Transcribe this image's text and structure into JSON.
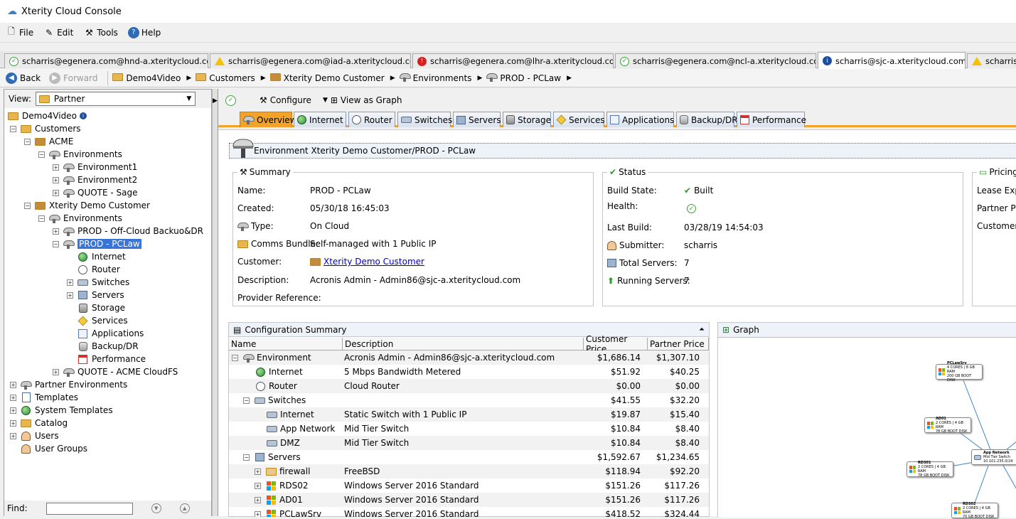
{
  "window": {
    "title": "Xterity Cloud Console"
  },
  "menu": [
    {
      "label": "File",
      "icon": "file-icon"
    },
    {
      "label": "Edit",
      "icon": "edit-icon"
    },
    {
      "label": "Tools",
      "icon": "tools-icon"
    },
    {
      "label": "Help",
      "icon": "help-icon"
    }
  ],
  "session_tabs": [
    {
      "label": "scharris@egenera.com@hnd-a.xteritycloud.com",
      "status": "ok"
    },
    {
      "label": "scharris@egenera.com@iad-a.xteritycloud.com",
      "status": "warning"
    },
    {
      "label": "scharris@egenera.com@lhr-a.xteritycloud.com",
      "status": "error"
    },
    {
      "label": "scharris@egenera.com@ncl-a.xteritycloud.com",
      "status": "ok"
    },
    {
      "label": "scharris@sjc-a.xteritycloud.com",
      "status": "info",
      "active": true
    },
    {
      "label": "scharris",
      "status": "warning"
    }
  ],
  "nav": {
    "back": "Back",
    "forward": "Forward",
    "breadcrumbs": [
      "Demo4Video",
      "Customers",
      "Xterity Demo Customer",
      "Environments",
      "PROD - PCLaw"
    ]
  },
  "left": {
    "view_label": "View:",
    "view_value": "Partner",
    "find_label": "Find:",
    "tree": [
      {
        "label": "Demo4Video",
        "info": true
      },
      {
        "label": "Customers"
      },
      {
        "label": "ACME"
      },
      {
        "label": "Environments"
      },
      {
        "label": "Environment1"
      },
      {
        "label": "Environment2"
      },
      {
        "label": "QUOTE - Sage"
      },
      {
        "label": "Xterity Demo Customer"
      },
      {
        "label": "Environments"
      },
      {
        "label": "PROD - Off-Cloud Backuo&DR"
      },
      {
        "label": "PROD - PCLaw"
      },
      {
        "label": "Internet"
      },
      {
        "label": "Router"
      },
      {
        "label": "Switches"
      },
      {
        "label": "Servers"
      },
      {
        "label": "Storage"
      },
      {
        "label": "Services"
      },
      {
        "label": "Applications"
      },
      {
        "label": "Backup/DR"
      },
      {
        "label": "Performance"
      },
      {
        "label": "QUOTE - ACME CloudFS"
      },
      {
        "label": "Partner Environments"
      },
      {
        "label": "Templates"
      },
      {
        "label": "System Templates"
      },
      {
        "label": "Catalog"
      },
      {
        "label": "Users"
      },
      {
        "label": "User Groups"
      }
    ]
  },
  "toolbar": {
    "configure": "Configure",
    "view_graph": "View as Graph"
  },
  "view_tabs": [
    "Overview",
    "Internet",
    "Router",
    "Switches",
    "Servers",
    "Storage",
    "Services",
    "Applications",
    "Backup/DR",
    "Performance"
  ],
  "env_header": "Environment Xterity Demo Customer/PROD - PCLaw",
  "summary": {
    "legend": "Summary",
    "name_label": "Name:",
    "name": "PROD - PCLaw",
    "created_label": "Created:",
    "created": "05/30/18 16:45:03",
    "type_label": "Type:",
    "type": "On Cloud",
    "comms_label": "Comms Bundle:",
    "comms": "Self-managed with 1 Public IP",
    "customer_label": "Customer:",
    "customer": "Xterity Demo Customer",
    "description_label": "Description:",
    "description": "Acronis Admin - Admin86@sjc-a.xteritycloud.com",
    "provider_ref_label": "Provider Reference:"
  },
  "status": {
    "legend": "Status",
    "build_state_label": "Build State:",
    "build_state": "Built",
    "health_label": "Health:",
    "last_build_label": "Last Build:",
    "last_build": "03/28/19 14:54:03",
    "submitter_label": "Submitter:",
    "submitter": "scharris",
    "total_servers_label": "Total Servers:",
    "total_servers": "7",
    "running_servers_label": "Running Servers:",
    "running_servers": "7"
  },
  "pricing": {
    "legend": "Pricing",
    "lease_label": "Lease Expir",
    "partner_label": "Partner Pric",
    "customer_label": "Customer P"
  },
  "config_summary": {
    "title": "Configuration Summary",
    "columns": [
      "Name",
      "Description",
      "Customer Price",
      "Partner Price"
    ],
    "rows": [
      {
        "name": "Environment",
        "description": "Acronis Admin - Admin86@sjc-a.xteritycloud.com",
        "customer_price": "$1,686.14",
        "partner_price": "$1,307.10"
      },
      {
        "name": "Internet",
        "description": "5 Mbps Bandwidth Metered",
        "customer_price": "$51.92",
        "partner_price": "$40.25"
      },
      {
        "name": "Router",
        "description": "Cloud Router",
        "customer_price": "$0.00",
        "partner_price": "$0.00"
      },
      {
        "name": "Switches",
        "description": "",
        "customer_price": "$41.55",
        "partner_price": "$32.20"
      },
      {
        "name": "Internet",
        "description": "Static Switch with 1 Public IP",
        "customer_price": "$19.87",
        "partner_price": "$15.40"
      },
      {
        "name": "App Network",
        "description": "Mid Tier Switch",
        "customer_price": "$10.84",
        "partner_price": "$8.40"
      },
      {
        "name": "DMZ",
        "description": "Mid Tier Switch",
        "customer_price": "$10.84",
        "partner_price": "$8.40"
      },
      {
        "name": "Servers",
        "description": "",
        "customer_price": "$1,592.67",
        "partner_price": "$1,234.65"
      },
      {
        "name": "firewall",
        "description": "FreeBSD",
        "customer_price": "$118.94",
        "partner_price": "$92.20"
      },
      {
        "name": "RDS02",
        "description": "Windows Server 2016 Standard",
        "customer_price": "$151.26",
        "partner_price": "$117.26"
      },
      {
        "name": "AD01",
        "description": "Windows Server 2016 Standard",
        "customer_price": "$151.26",
        "partner_price": "$117.26"
      },
      {
        "name": "PCLawSrv",
        "description": "Windows Server 2016 Standard",
        "customer_price": "$418.52",
        "partner_price": "$324.44"
      }
    ]
  },
  "graph": {
    "title": "Graph",
    "nodes": [
      {
        "name": "PCLawSrv",
        "l1": "4 CORES | 8 GB RAM",
        "l2": "200 GB BOOT DISK"
      },
      {
        "name": "AD01",
        "l1": "2 CORES | 4 GB RAM",
        "l2": "78 GB BOOT DISK"
      },
      {
        "name": "App Network",
        "l1": "Mid Tier Switch",
        "l2": "10.101.235.0/24"
      },
      {
        "name": "RDS01",
        "l1": "2 CORES | 4 GB RAM",
        "l2": "78 GB BOOT DISK"
      },
      {
        "name": "RDS02",
        "l1": "2 CORES | 4 GB RAM",
        "l2": "70 GB BOOT DISK"
      }
    ]
  },
  "colors": {
    "accent_tab": "#f4a328",
    "selection": "#3875d7",
    "link": "#0000cc"
  }
}
